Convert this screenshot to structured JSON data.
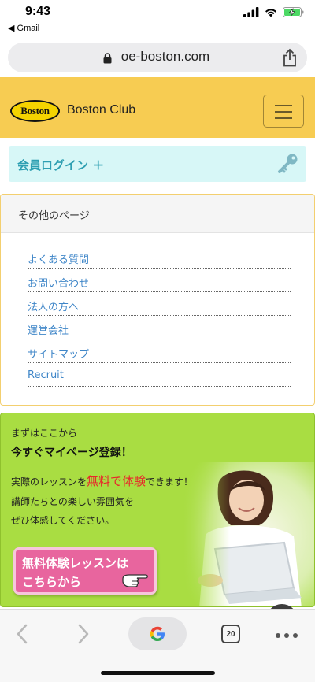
{
  "status_bar": {
    "time": "9:43",
    "back_app": "◀ Gmail"
  },
  "browser": {
    "url": "oe-boston.com",
    "tab_count": "20"
  },
  "site": {
    "logo_text": "Boston",
    "brand_name": "Boston Club"
  },
  "login": {
    "label": "会員ログイン ＋"
  },
  "other_pages": {
    "title": "その他のページ",
    "links": [
      {
        "label": "よくある質問"
      },
      {
        "label": "お問い合わせ"
      },
      {
        "label": "法人の方へ"
      },
      {
        "label": "運営会社"
      },
      {
        "label": "サイトマップ"
      },
      {
        "label": "Recruit"
      }
    ]
  },
  "promo": {
    "subtitle": "まずはここから",
    "headline": "今すぐマイページ登録！",
    "line1_pre": "実際のレッスンを",
    "line1_highlight": "無料で体験",
    "line1_post": "できます！",
    "line2": "講師たちとの楽しい雰囲気を",
    "line3": "ぜひ体感してください。",
    "button_line1": "無料体験レッスンは",
    "button_line2": "こちらから"
  },
  "colors": {
    "header_bg": "#f7cc52",
    "login_bg": "#d7f7f7",
    "link_blue": "#3f86c8",
    "promo_bg": "#a9dd42",
    "promo_button": "#e8659e",
    "highlight_red": "#e8262b"
  }
}
